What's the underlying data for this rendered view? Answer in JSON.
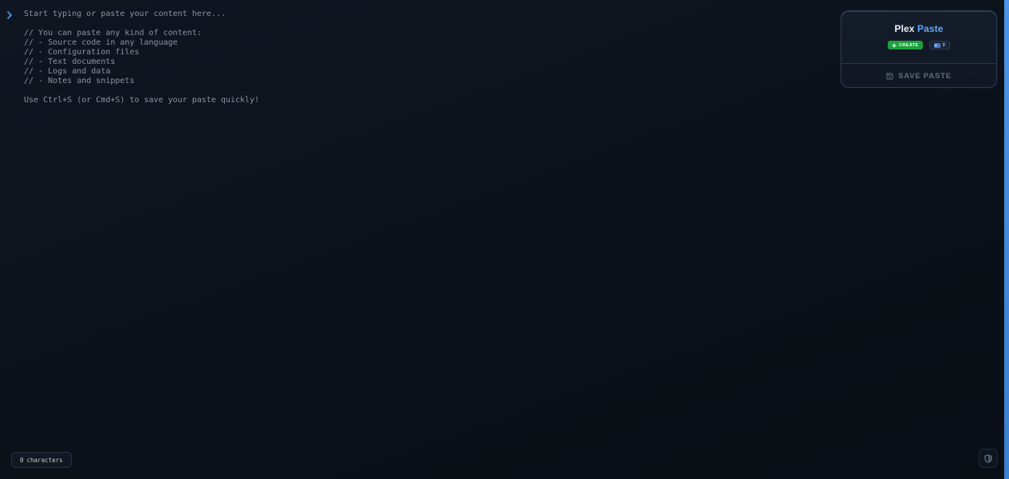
{
  "editor": {
    "placeholder": "Start typing or paste your content here...\n\n// You can paste any kind of content:\n// - Source code in any language\n// - Configuration files\n// - Text documents\n// - Logs and data\n// - Notes and snippets\n\nUse Ctrl+S (or Cmd+S) to save your paste quickly!",
    "value": ""
  },
  "brand": {
    "part1": "Plex",
    "part2": "Paste"
  },
  "badges": {
    "create_label": "CREATE",
    "count": "0"
  },
  "save_button": {
    "label": "SAVE PASTE"
  },
  "status": {
    "char_count": "0",
    "char_label": "characters"
  },
  "colors": {
    "accent": "#5aa9ff",
    "create_badge": "#1f9e3f",
    "background": "#0c111a"
  },
  "icons": {
    "prompt": "chevron-right-icon",
    "create": "plus-icon",
    "count": "id-card-icon",
    "save": "floppy-disk-icon",
    "privacy": "shield-icon"
  }
}
